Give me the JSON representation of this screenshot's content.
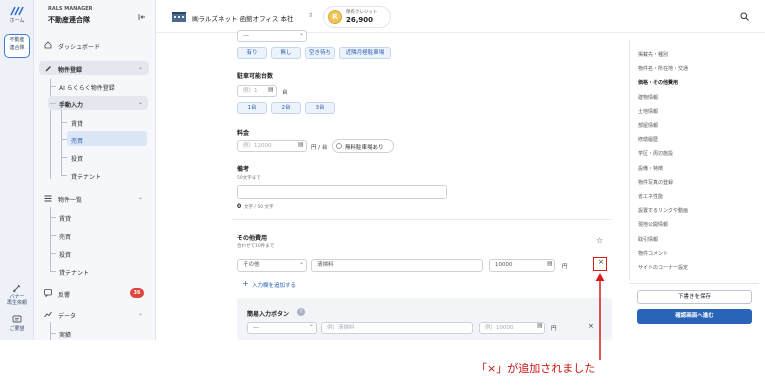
{
  "rail": {
    "home_label": "ホーム",
    "org_label_1": "不動産",
    "org_label_2": "連合隊",
    "banner_label_1": "バナー",
    "banner_label_2": "再生依頼",
    "request_label": "ご要望"
  },
  "brand": {
    "small": "RALS MANAGER",
    "name": "不動産連合隊"
  },
  "sidebar": {
    "dashboard": "ダッシュボード",
    "property_register": "物件登録",
    "ai_register": "AI らくらく物件登録",
    "manual_input": "手動入力",
    "manual_items": [
      "賃貸",
      "売買",
      "投資",
      "貸テナント"
    ],
    "property_list": "物件一覧",
    "list_items": [
      "賃貸",
      "売買",
      "投資",
      "貸テナント"
    ],
    "responses": "反響",
    "responses_badge": "36",
    "data": "データ",
    "data_items": [
      "実績"
    ]
  },
  "topbar": {
    "company": "㈱ラルズネット 函館オフィス 本社",
    "credit_label": "保有クレジット",
    "credit_value": "26,900",
    "coin_letter": "R"
  },
  "form": {
    "top_select": "---",
    "parking_options": [
      "有り",
      "無し",
      "空き待ち",
      "近隣月極駐車場"
    ],
    "parking_count_label": "駐車可能台数",
    "parking_count_placeholder": "例）1",
    "parking_count_unit": "台",
    "parking_count_chips": [
      "1台",
      "2台",
      "3台"
    ],
    "fee_label": "料金",
    "fee_placeholder": "例）12000",
    "fee_unit": "円 / 台",
    "free_parking_label": "無料駐車場あり",
    "remarks_label": "備考",
    "remarks_hint": "50文字まで",
    "remarks_count": "0",
    "remarks_count_suffix": "文字 / 50 文字",
    "other_cost_label": "その他費用",
    "other_cost_hint": "合わせて10件まで",
    "row": {
      "category": "その他",
      "name": "清掃料",
      "amount": "10000",
      "unit": "円",
      "remove": "×"
    },
    "add_row": "入力欄を追加する",
    "bulk_label": "簡易入力ボタン",
    "bulk_row": {
      "category": "---",
      "name_placeholder": "例）清掃料",
      "amount_placeholder": "例）10000",
      "unit": "円",
      "remove": "×"
    }
  },
  "index": {
    "items": [
      "掲載先・種別",
      "物件名・所在地・交通",
      "価格・その他費用",
      "建物情報",
      "土地情報",
      "部屋情報",
      "修繕履歴",
      "学区・周辺施設",
      "設備・特徴",
      "物件写真の登録",
      "省エネ性能",
      "設置するリンクや動画",
      "現地公開情報",
      "取引情報",
      "物件コメント",
      "サイトのコーナー設定"
    ],
    "active_index": 2,
    "save_draft": "下書きを保存",
    "confirm": "確認画面へ進む"
  },
  "annotation": {
    "text": "「×」が追加されました",
    "color": "#d81b1b"
  }
}
